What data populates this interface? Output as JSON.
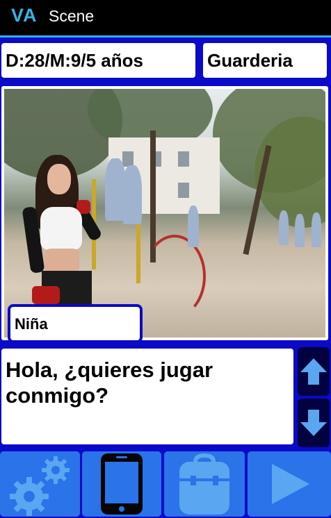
{
  "actionbar": {
    "logo": "VA",
    "title": "Scene"
  },
  "info": {
    "date_age": "D:28/M:9/5 años",
    "place": "Guarderia"
  },
  "scene": {
    "speaker": "Niña"
  },
  "dialog": {
    "text": "Hola, ¿quieres jugar conmigo?"
  },
  "scroll": {
    "up_icon": "arrow-up-icon",
    "down_icon": "arrow-down-icon"
  },
  "toolbar": {
    "buttons": [
      {
        "icon": "gears-icon"
      },
      {
        "icon": "smartphone-icon"
      },
      {
        "icon": "backpack-icon"
      },
      {
        "icon": "play-icon"
      }
    ]
  },
  "colors": {
    "background": "#0a0ac8",
    "accent": "#33b5e5",
    "toolbar_button": "#2a73e8",
    "scroll_button": "#020240",
    "icon_light": "#5aa6f0"
  }
}
